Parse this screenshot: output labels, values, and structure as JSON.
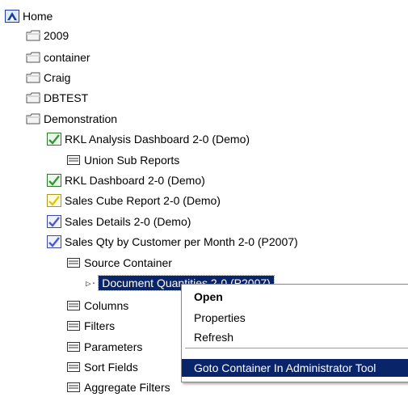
{
  "tree": {
    "root": {
      "label": "Home",
      "icon": "home-icon"
    },
    "folders": [
      {
        "label": "2009",
        "icon": "folder-icon"
      },
      {
        "label": "container",
        "icon": "folder-icon"
      },
      {
        "label": "Craig",
        "icon": "folder-icon"
      },
      {
        "label": "DBTEST",
        "icon": "folder-icon"
      },
      {
        "label": "Demonstration",
        "icon": "folder-icon"
      }
    ],
    "reports": [
      {
        "label": "RKL Analysis Dashboard 2-0 (Demo)",
        "icon": "report-check-icon"
      },
      {
        "label": "Union Sub Reports",
        "icon": "subreport-icon"
      },
      {
        "label": "RKL Dashboard 2-0 (Demo)",
        "icon": "report-check-icon"
      },
      {
        "label": "Sales Cube Report 2-0 (Demo)",
        "icon": "report-yellow-icon"
      },
      {
        "label": "Sales Details 2-0 (Demo)",
        "icon": "report-blue-icon"
      },
      {
        "label": "Sales Qty by Customer per Month 2-0 (P2007)",
        "icon": "report-blue-icon"
      }
    ],
    "children": [
      {
        "label": "Source Container",
        "icon": "subreport-icon"
      },
      {
        "label": "Document Quantities 2-0 (P2007)",
        "icon": "document-link-icon",
        "selected": true
      },
      {
        "label": "Columns",
        "icon": "subreport-icon"
      },
      {
        "label": "Filters",
        "icon": "subreport-icon"
      },
      {
        "label": "Parameters",
        "icon": "subreport-icon"
      },
      {
        "label": "Sort Fields",
        "icon": "subreport-icon"
      },
      {
        "label": "Aggregate Filters",
        "icon": "subreport-icon"
      }
    ]
  },
  "context_menu": {
    "items": [
      {
        "label": "Open",
        "bold": true
      },
      {
        "label": "Properties"
      },
      {
        "label": "Refresh"
      },
      {
        "label": "Goto Container In Administrator Tool",
        "selected": true
      }
    ]
  },
  "colors": {
    "selection": "#0a246a",
    "folder": "#f0f0f0",
    "check_green": "#2f9a2f"
  }
}
